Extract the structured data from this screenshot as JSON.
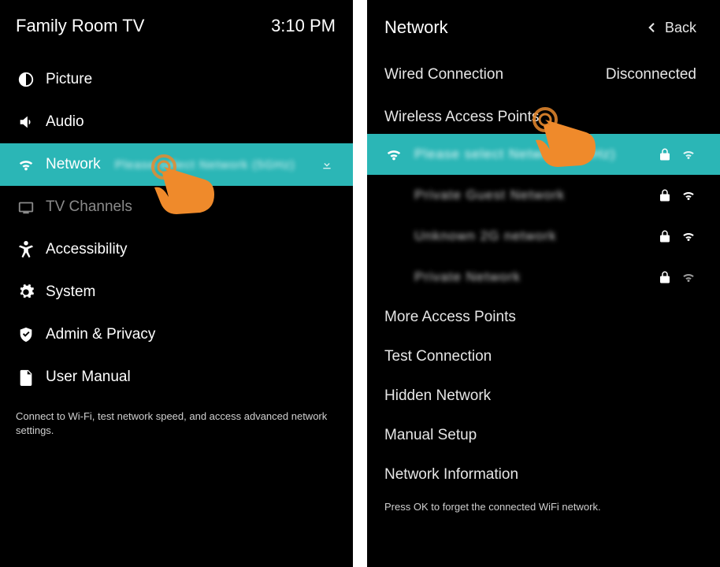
{
  "left": {
    "title": "Family Room TV",
    "time": "3:10 PM",
    "menu": {
      "picture": "Picture",
      "audio": "Audio",
      "network": "Network",
      "network_sub": "Please select Network (5GHz)",
      "tv_channels": "TV Channels",
      "accessibility": "Accessibility",
      "system": "System",
      "admin_privacy": "Admin & Privacy",
      "user_manual": "User Manual"
    },
    "hint": "Connect to Wi-Fi, test network speed, and access advanced network settings."
  },
  "right": {
    "title": "Network",
    "back": "Back",
    "wired_label": "Wired Connection",
    "wired_status": "Disconnected",
    "wap_label": "Wireless Access Points",
    "aps": [
      {
        "name": "Please select Network (5GHz)",
        "selected": true
      },
      {
        "name": "Private Guest Network",
        "selected": false
      },
      {
        "name": "Unknown 2G network",
        "selected": false
      },
      {
        "name": "Private Network",
        "selected": false
      }
    ],
    "options": {
      "more": "More Access Points",
      "test": "Test Connection",
      "hidden": "Hidden Network",
      "manual": "Manual Setup",
      "info": "Network Information"
    },
    "hint": "Press OK to forget the connected WiFi network."
  }
}
